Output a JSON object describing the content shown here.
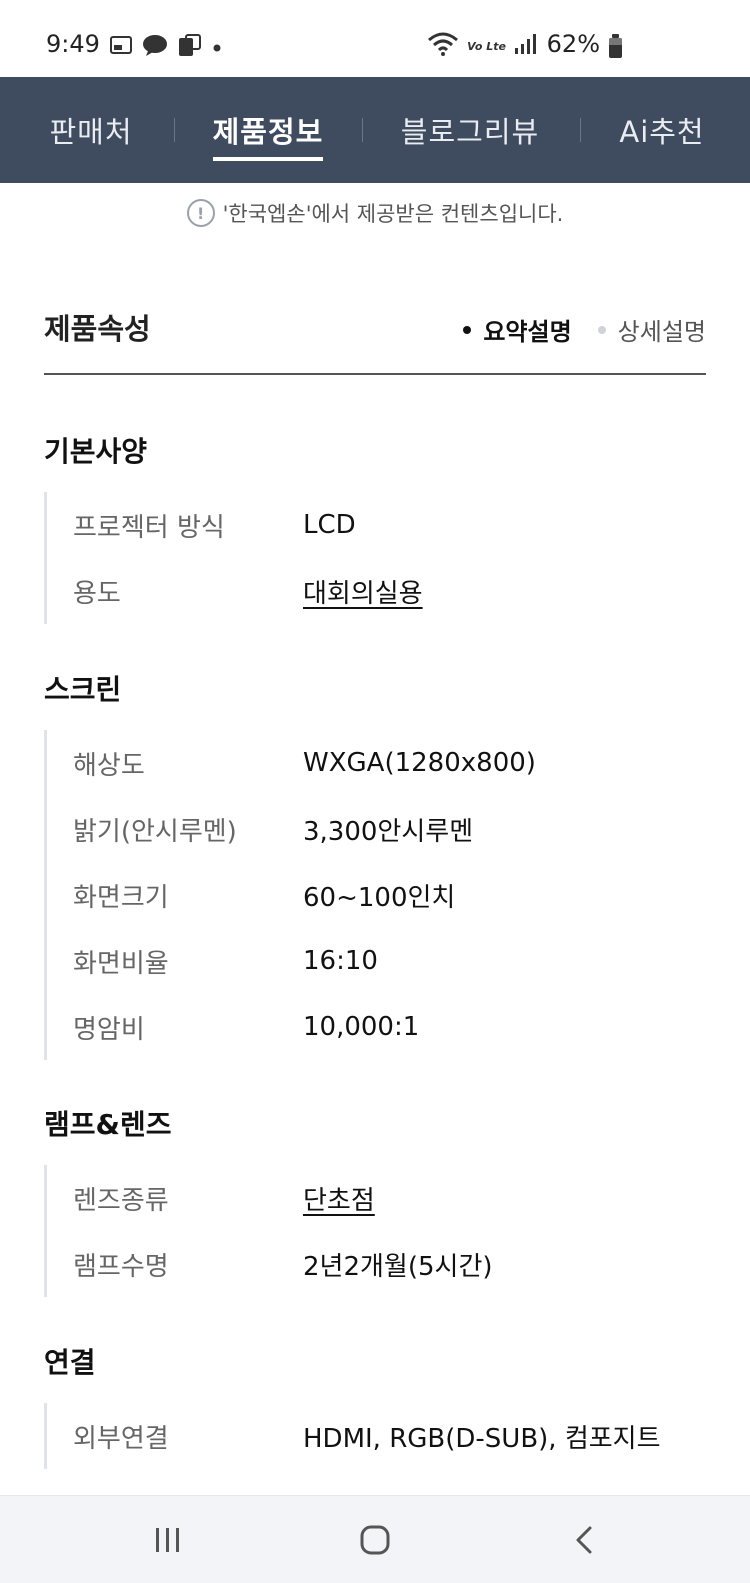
{
  "status_bar": {
    "time": "9:49",
    "battery": "62%",
    "left_icons": [
      "message-icon",
      "chat-icon",
      "phone-icon",
      "dot-icon"
    ],
    "right_icons": [
      "wifi-icon",
      "volte-icon",
      "signal-icon",
      "battery-icon"
    ],
    "volte_label": "Vo Lte"
  },
  "tabs": [
    {
      "label": "판매처",
      "active": false
    },
    {
      "label": "제품정보",
      "active": true
    },
    {
      "label": "블로그리뷰",
      "active": false
    },
    {
      "label": "Ai추천",
      "active": false
    }
  ],
  "notice": {
    "text": "'한국엡손'에서 제공받은 컨텐츠입니다."
  },
  "props": {
    "title": "제품속성",
    "summary_label": "요약설명",
    "detail_label": "상세설명"
  },
  "groups": [
    {
      "title": "기본사양",
      "rows": [
        {
          "label": "프로젝터 방식",
          "value": "LCD"
        },
        {
          "label": "용도",
          "value": "대회의실용"
        }
      ]
    },
    {
      "title": "스크린",
      "rows": [
        {
          "label": "해상도",
          "value": "WXGA(1280x800)"
        },
        {
          "label": "밝기(안시루멘)",
          "value": "3,300안시루멘"
        },
        {
          "label": "화면크기",
          "value": "60~100인치"
        },
        {
          "label": "화면비율",
          "value": "16:10"
        },
        {
          "label": "명암비",
          "value": "10,000:1"
        }
      ]
    },
    {
      "title": "램프&렌즈",
      "rows": [
        {
          "label": "렌즈종류",
          "value": "단초점"
        },
        {
          "label": "램프수명",
          "value": "2년2개월(5시간)"
        }
      ]
    },
    {
      "title": "연결",
      "rows": [
        {
          "label": "외부연결",
          "value": "HDMI, RGB(D-SUB), 컴포지트"
        }
      ]
    }
  ],
  "bottom_nav": [
    "recent-apps-icon",
    "home-icon",
    "back-icon"
  ]
}
